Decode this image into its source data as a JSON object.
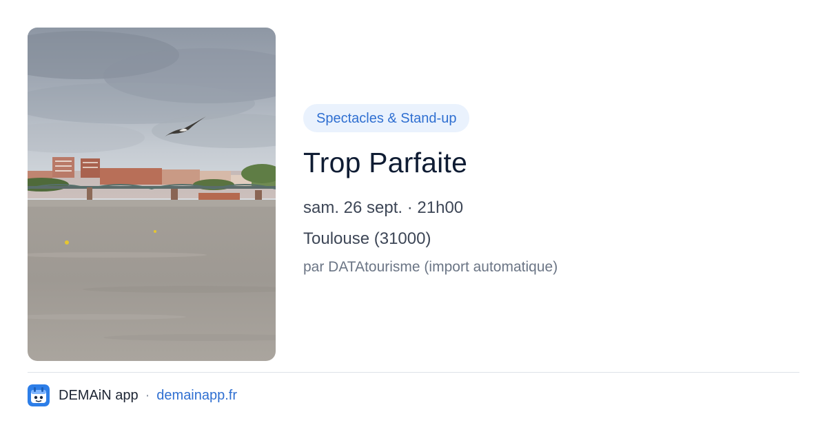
{
  "event": {
    "category": "Spectacles & Stand-up",
    "title": "Trop Parfaite",
    "datetime": "sam. 26 sept. · 21h00",
    "place": "Toulouse (31000)",
    "source": "par DATAtourisme (import automatique)",
    "image_icon": "river-bridge-photo"
  },
  "footer": {
    "app_name": "DEMAiN app",
    "separator": "·",
    "url": "demainapp.fr",
    "icon": "demain-app-icon"
  },
  "colors": {
    "accent": "#2f6fd1",
    "badge_bg": "#eaf2fd",
    "title": "#0f1c33",
    "body": "#3d4656",
    "muted": "#6b7585"
  }
}
